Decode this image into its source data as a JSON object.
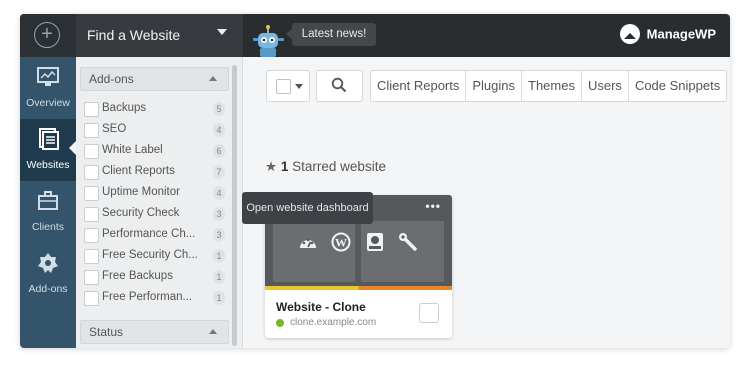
{
  "topbar": {
    "add_icon": "plus-circle-icon",
    "find_label": "Find a Website",
    "news_label": "Latest news!",
    "brand": "ManageWP"
  },
  "nav": {
    "items": [
      {
        "label": "Overview",
        "icon": "monitor-icon"
      },
      {
        "label": "Websites",
        "icon": "document-stack-icon",
        "active": true
      },
      {
        "label": "Clients",
        "icon": "briefcase-icon"
      },
      {
        "label": "Add-ons",
        "icon": "badge-gear-icon"
      }
    ]
  },
  "filters": {
    "addons_header": "Add-ons",
    "addons": [
      {
        "name": "Backups",
        "count": "5"
      },
      {
        "name": "SEO",
        "count": "4"
      },
      {
        "name": "White Label",
        "count": "6"
      },
      {
        "name": "Client Reports",
        "count": "7"
      },
      {
        "name": "Uptime Monitor",
        "count": "4"
      },
      {
        "name": "Security Check",
        "count": "3"
      },
      {
        "name": "Performance Ch...",
        "count": "3"
      },
      {
        "name": "Free Security Ch...",
        "count": "1"
      },
      {
        "name": "Free Backups",
        "count": "1"
      },
      {
        "name": "Free Performan...",
        "count": "1"
      }
    ],
    "status_header": "Status"
  },
  "toolbar": {
    "tabs": [
      "Client Reports",
      "Plugins",
      "Themes",
      "Users",
      "Code Snippets"
    ]
  },
  "main": {
    "starred_count": "1",
    "starred_label": "Starred website"
  },
  "card": {
    "title": "Website - Clone",
    "url": "clone.example.com",
    "menu": "•••",
    "status_color": "#76b82a"
  },
  "tooltip": "Open website dashboard"
}
